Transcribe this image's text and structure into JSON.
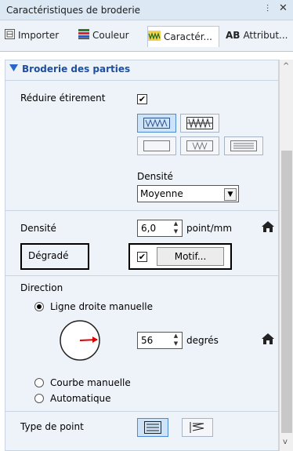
{
  "window": {
    "title": "Caractéristiques de broderie",
    "pin_icon": "pin-icon",
    "close_icon": "close-icon"
  },
  "tabs": [
    {
      "label": "Importer",
      "icon": "import-icon"
    },
    {
      "label": "Couleur",
      "icon": "color-icon"
    },
    {
      "label": "Caractér...",
      "icon": "sewing-attributes-icon",
      "active": true
    },
    {
      "label": "Attribut...",
      "icon_text": "AB"
    }
  ],
  "section": {
    "title": "Broderie des parties",
    "expand_icon": "triangle-down-icon"
  },
  "reduce_stretch": {
    "label": "Réduire étirement",
    "checked": true,
    "check_glyph": "✔"
  },
  "stitch_direction_icons": [
    "wave-stitch-icon",
    "grid-stitch-icon",
    "rect-outline-icon",
    "wave-small-icon",
    "lines-icon"
  ],
  "density_select": {
    "label": "Densité",
    "value": "Moyenne",
    "arrow": "▼"
  },
  "density": {
    "label": "Densité",
    "value": "6,0",
    "unit": "point/mm",
    "home_icon": "home-icon"
  },
  "gradient": {
    "label": "Dégradé",
    "checked": true,
    "check_glyph": "✔",
    "button": "Motif..."
  },
  "direction": {
    "label": "Direction",
    "options": [
      {
        "label": "Ligne droite manuelle",
        "selected": true
      },
      {
        "label": "Courbe manuelle",
        "selected": false
      },
      {
        "label": "Automatique",
        "selected": false
      }
    ],
    "angle": {
      "value": "56",
      "unit": "degrés",
      "home_icon": "home-icon"
    }
  },
  "stitch_type": {
    "label": "Type de point",
    "icons": [
      "fill-stitch-icon",
      "zigzag-stitch-icon"
    ]
  },
  "colors": {
    "accent": "#1f4f9c",
    "arrow": "#e00000"
  }
}
